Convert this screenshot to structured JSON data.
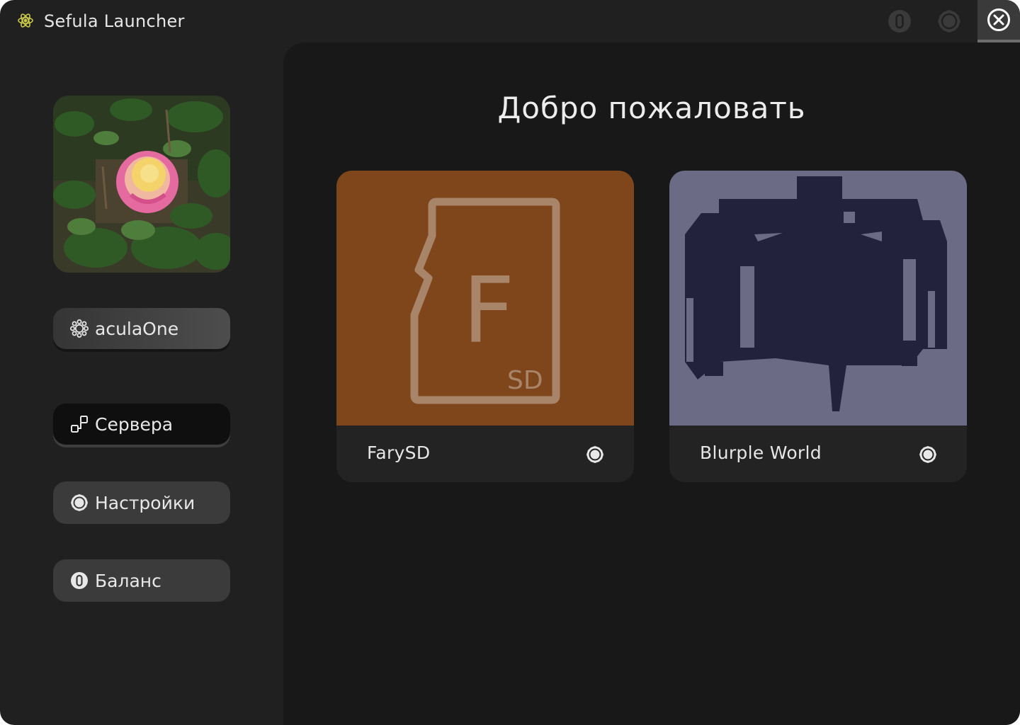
{
  "app": {
    "title": "Sefula Launcher",
    "logo_icon": "atom-gear-icon",
    "accent": "#c9c94a"
  },
  "titlebar": {
    "buttons": [
      {
        "icon": "balance-coin-icon"
      },
      {
        "icon": "settings-gear-icon"
      },
      {
        "icon": "close-icon"
      }
    ]
  },
  "sidebar": {
    "avatar_alt": "rose-photo",
    "user": {
      "label": "aculaOne",
      "icon": "user-gear-icon"
    },
    "servers": {
      "label": "Сервера",
      "icon": "servers-icon"
    },
    "settings": {
      "label": "Настройки",
      "icon": "settings-gear-icon"
    },
    "balance": {
      "label": "Баланс",
      "icon": "balance-coin-icon"
    }
  },
  "main": {
    "welcome": "Добро пожаловать",
    "servers": [
      {
        "name": "FarySD",
        "bg": "#7f451b",
        "image_text_big": "F",
        "image_text_small": "SD",
        "icon": "gear-icon"
      },
      {
        "name": "Blurple World",
        "bg": "#6b6b85",
        "icon": "gear-icon"
      }
    ]
  }
}
